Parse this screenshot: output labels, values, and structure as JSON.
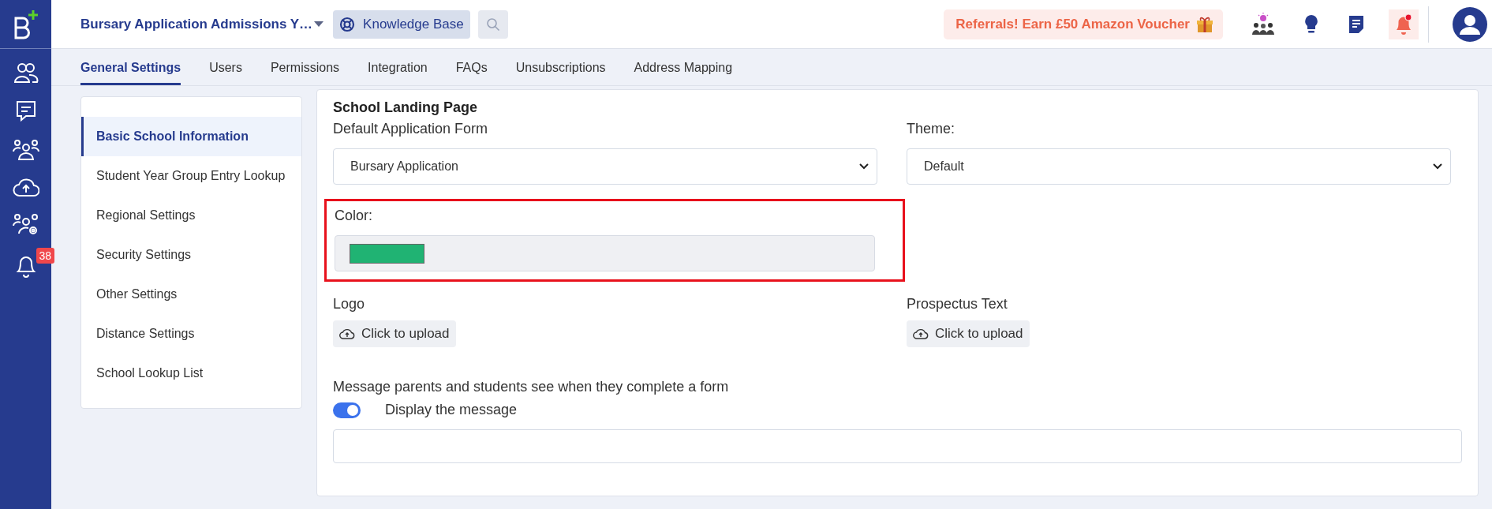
{
  "header": {
    "title": "Bursary Application Admissions Y…",
    "knowledge_base": "Knowledge Base",
    "referral": "Referrals! Earn £50 Amazon Voucher"
  },
  "rail": {
    "notification_count": "38"
  },
  "tabs": [
    {
      "label": "General Settings",
      "selected": true
    },
    {
      "label": "Users",
      "selected": false
    },
    {
      "label": "Permissions",
      "selected": false
    },
    {
      "label": "Integration",
      "selected": false
    },
    {
      "label": "FAQs",
      "selected": false
    },
    {
      "label": "Unsubscriptions",
      "selected": false
    },
    {
      "label": "Address Mapping",
      "selected": false
    }
  ],
  "sidebar": {
    "items": [
      {
        "label": "Basic School Information",
        "selected": true
      },
      {
        "label": "Student Year Group Entry Lookup",
        "selected": false
      },
      {
        "label": "Regional Settings",
        "selected": false
      },
      {
        "label": "Security Settings",
        "selected": false
      },
      {
        "label": "Other Settings",
        "selected": false
      },
      {
        "label": "Distance Settings",
        "selected": false
      },
      {
        "label": "School Lookup List",
        "selected": false
      }
    ]
  },
  "form": {
    "heading": "School Landing Page",
    "default_form": {
      "label": "Default Application Form",
      "value": "Bursary Application"
    },
    "theme": {
      "label": "Theme:",
      "value": "Default"
    },
    "color": {
      "label": "Color:",
      "color": "#20b373",
      "highlighted": true
    },
    "logo": {
      "label": "Logo",
      "button": "Click to upload"
    },
    "prospectus": {
      "label": "Prospectus Text",
      "button": "Click to upload"
    },
    "message": {
      "label": "Message parents and students see when they complete a form",
      "toggle_label": "Display the message",
      "on": true
    }
  }
}
